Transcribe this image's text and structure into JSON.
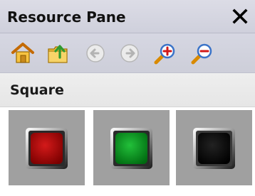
{
  "pane": {
    "title": "Resource Pane",
    "close_icon": "close-icon"
  },
  "toolbar": {
    "buttons": [
      {
        "icon": "home-icon"
      },
      {
        "icon": "folder-up-icon"
      },
      {
        "icon": "back-arrow-icon"
      },
      {
        "icon": "forward-arrow-icon"
      },
      {
        "icon": "zoom-in-icon"
      },
      {
        "icon": "zoom-out-icon"
      }
    ]
  },
  "section": {
    "label": "Square"
  },
  "resources": [
    {
      "name": "red-square-button",
      "color": "#b00000"
    },
    {
      "name": "green-square-button",
      "color": "#0a9a1e"
    },
    {
      "name": "black-square-button",
      "color": "#0a0a0a"
    }
  ],
  "colors": {
    "titlebar": "#d3d4df",
    "toolbar": "#d1d2dd",
    "section": "#eaeaea",
    "tile": "#a0a0a0"
  }
}
